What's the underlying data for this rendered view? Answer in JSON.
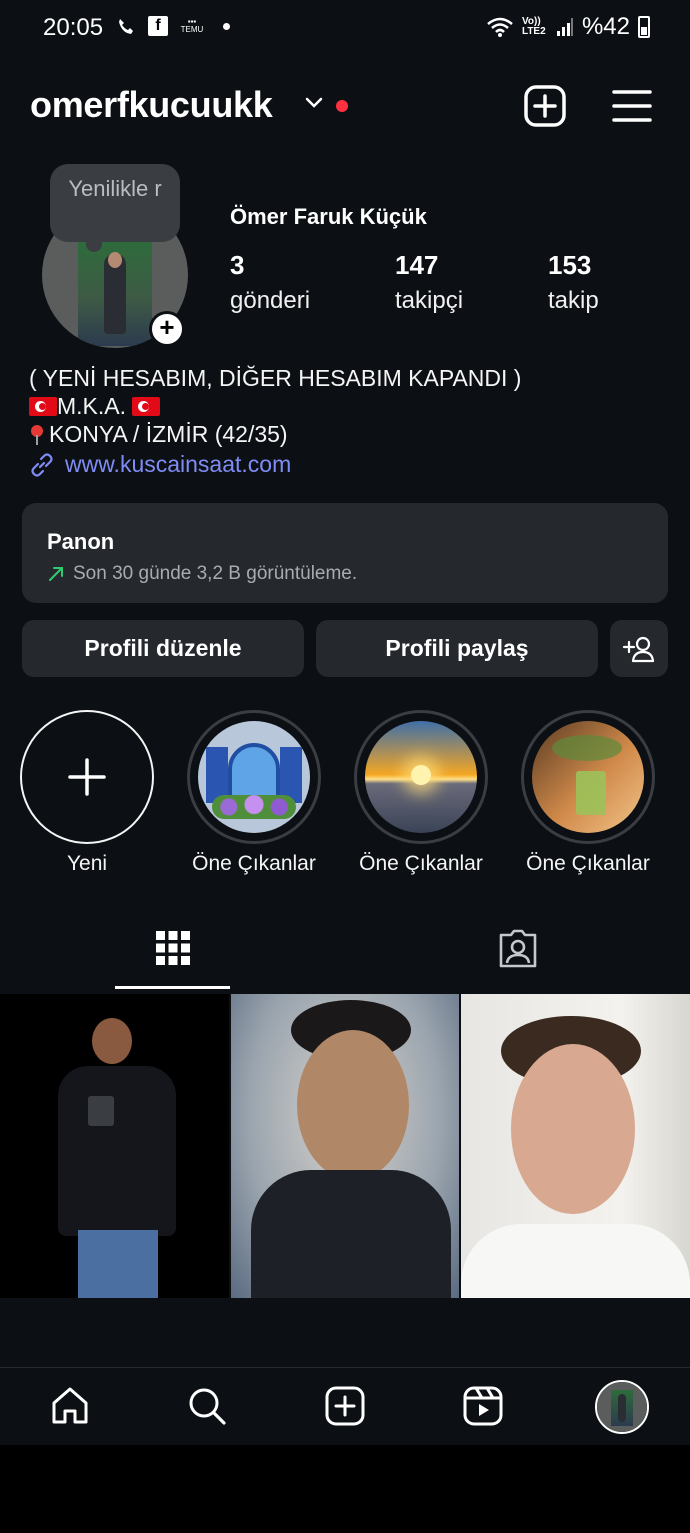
{
  "status_bar": {
    "time": "20:05",
    "battery": "%42",
    "icons": [
      "missed-call-icon",
      "facebook-icon",
      "temu-icon",
      "dot-icon",
      "wifi-icon",
      "volte-icon",
      "signal-icon",
      "battery-icon"
    ],
    "network_label": "Vo)) LTE2"
  },
  "header": {
    "username": "omerfkucuukk",
    "icons": [
      "chevron-down-icon",
      "notification-dot",
      "new-post-icon",
      "menu-icon"
    ]
  },
  "profile": {
    "note": "Yenilikle r",
    "full_name": "Ömer Faruk Küçük",
    "stats": [
      {
        "value": "3",
        "label": "gönderi"
      },
      {
        "value": "147",
        "label": "takipçi"
      },
      {
        "value": "153",
        "label": "takip"
      }
    ]
  },
  "bio": {
    "line1": "( YENİ HESABIM, DİĞER HESABIM KAPANDI )",
    "line2": "M.K.A.",
    "line3": "KONYA / İZMİR (42/35)",
    "link": "www.kuscainsaat.com"
  },
  "dashboard": {
    "title": "Panon",
    "subtitle": "Son 30 günde 3,2 B görüntüleme."
  },
  "actions": {
    "edit_profile": "Profili düzenle",
    "share_profile": "Profili paylaş"
  },
  "highlights": [
    {
      "label": "Yeni"
    },
    {
      "label": "Öne Çıkanlar"
    },
    {
      "label": "Öne Çıkanlar"
    },
    {
      "label": "Öne Çıkanlar"
    }
  ],
  "tabs": [
    "grid-icon",
    "tagged-icon"
  ],
  "colors": {
    "background": "#0c1014",
    "link": "#7f8cf5",
    "card": "#25292e",
    "notification": "#ff3040"
  },
  "bottom_nav": [
    "home-icon",
    "search-icon",
    "create-icon",
    "reels-icon",
    "profile-avatar"
  ]
}
